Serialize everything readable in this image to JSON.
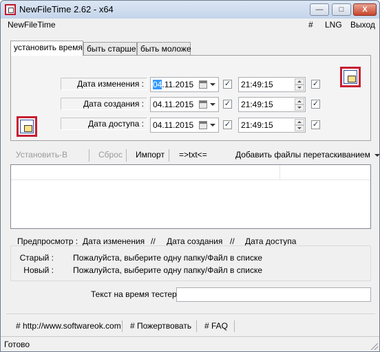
{
  "window": {
    "title": "NewFileTime 2.62 - x64",
    "minimize_symbol": "—",
    "maximize_symbol": "□",
    "close_symbol": "X"
  },
  "menu": {
    "app": "NewFileTime",
    "hash": "#",
    "lng": "LNG",
    "exit": "Выход"
  },
  "tabs": [
    {
      "label": "установить время",
      "active": true
    },
    {
      "label": "быть старше",
      "active": false
    },
    {
      "label": "быть моложе",
      "active": false
    }
  ],
  "rows": [
    {
      "label": "Дата изменения :",
      "date_selected": "04",
      "date_rest": ".11.2015",
      "date_checked": true,
      "time": "21:49:15",
      "time_checked": true
    },
    {
      "label": "Дата создания :",
      "date": "04.11.2015",
      "date_checked": true,
      "time": "21:49:15",
      "time_checked": true
    },
    {
      "label": "Дата доступа :",
      "date": "04.11.2015",
      "date_checked": true,
      "time": "21:49:15",
      "time_checked": true
    }
  ],
  "checkmark": "✓",
  "toolbar": {
    "set_b": "Установить-В",
    "reset": "Сброс",
    "import": "Импорт",
    "txt": "=>txt<=",
    "add_files": "Добавить файлы перетаскиванием"
  },
  "preview": {
    "label": "Предпросмотр  :",
    "modified": "Дата изменения",
    "sep1": "//",
    "created": "Дата создания",
    "sep2": "//",
    "accessed": "Дата доступа"
  },
  "info": {
    "old_label": "Старый :",
    "old_value": "Пожалуйста, выберите одну папку/Файл в списке",
    "new_label": "Новый :",
    "new_value": "Пожалуйста, выберите одну папку/Файл в списке"
  },
  "tester": {
    "label": "Текст на время тестер",
    "value": ""
  },
  "links": {
    "website": "# http://www.softwareok.com",
    "donate": "# Пожертвовать",
    "faq": "# FAQ"
  },
  "status": "Готово"
}
